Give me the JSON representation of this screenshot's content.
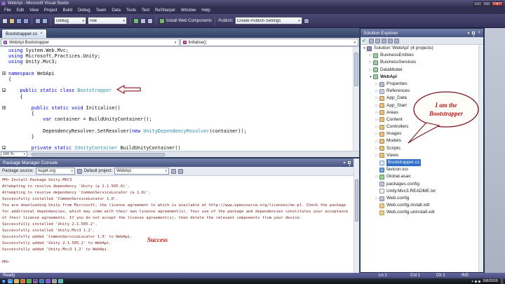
{
  "glyphs": {
    "chevron": "▾",
    "close": "×",
    "minimize": "–",
    "maximize": "□",
    "close_window": "✕",
    "expander_collapsed": "▷",
    "expander_expanded": "▾",
    "check": "✓",
    "tray_arrow": "▴",
    "vs_logo": "∞"
  },
  "colors": {
    "keyword": "#0000dd",
    "type": "#2b91af",
    "console_text": "#7b2323",
    "annotation_red": "#cc1111",
    "selection_blue": "#3170c8"
  },
  "titlebar": {
    "title": "WebApi - Microsoft Visual Studio"
  },
  "menubar": {
    "items": [
      "File",
      "Edit",
      "View",
      "Project",
      "Build",
      "Debug",
      "Team",
      "Data",
      "Tools",
      "Test",
      "ReSharper",
      "Window",
      "Help"
    ]
  },
  "toolbar": {
    "debug": "Debug",
    "role": "role",
    "install_web": "Install Web Components",
    "publish_label": "Publish:",
    "publish_value": "Create Publish Settings"
  },
  "editor": {
    "tab": "Bootstrapper.cs",
    "breadcrumb_type": "WebApi.Bootstrapper",
    "breadcrumb_member": "Initialise()",
    "zoom": "100 %",
    "outline_lines": [
      4,
      7,
      10,
      17
    ],
    "code": [
      [
        {
          "t": "using",
          "c": "k"
        },
        {
          "t": " System.Web.Mvc;",
          "c": "p"
        }
      ],
      [
        {
          "t": "using",
          "c": "k"
        },
        {
          "t": " Microsoft.Practices.Unity;",
          "c": "p"
        }
      ],
      [
        {
          "t": "using",
          "c": "k"
        },
        {
          "t": " Unity.Mvc3;",
          "c": "p"
        }
      ],
      [],
      [
        {
          "t": "namespace",
          "c": "k"
        },
        {
          "t": " WebApi",
          "c": "p"
        }
      ],
      [
        {
          "t": "{",
          "c": "p"
        }
      ],
      [],
      [
        {
          "t": "    ",
          "c": "p"
        },
        {
          "t": "public static class",
          "c": "k"
        },
        {
          "t": " ",
          "c": "p"
        },
        {
          "t": "Bootstrapper",
          "c": "t"
        }
      ],
      [
        {
          "t": "    {",
          "c": "p"
        }
      ],
      [],
      [
        {
          "t": "        ",
          "c": "p"
        },
        {
          "t": "public static void",
          "c": "k"
        },
        {
          "t": " Initialise()",
          "c": "p"
        }
      ],
      [
        {
          "t": "        {",
          "c": "p"
        }
      ],
      [
        {
          "t": "            ",
          "c": "p"
        },
        {
          "t": "var",
          "c": "k"
        },
        {
          "t": " container = BuildUnityContainer();",
          "c": "p"
        }
      ],
      [],
      [
        {
          "t": "            DependencyResolver.SetResolver(",
          "c": "p"
        },
        {
          "t": "new",
          "c": "k"
        },
        {
          "t": " ",
          "c": "p"
        },
        {
          "t": "UnityDependencyResolver",
          "c": "t"
        },
        {
          "t": "(container));",
          "c": "p"
        }
      ],
      [
        {
          "t": "        }",
          "c": "p"
        }
      ],
      [],
      [
        {
          "t": "        ",
          "c": "p"
        },
        {
          "t": "private static",
          "c": "k"
        },
        {
          "t": " ",
          "c": "p"
        },
        {
          "t": "IUnityContainer",
          "c": "t"
        },
        {
          "t": " BuildUnityContainer()",
          "c": "p"
        }
      ]
    ]
  },
  "console": {
    "title": "Package Manager Console",
    "package_source_label": "Package source:",
    "package_source": "nuget.org",
    "default_project_label": "Default project:",
    "default_project": "WebApi",
    "annotation": "Success",
    "lines": [
      "PM> Install-Package Unity.MVC3",
      "Attempting to resolve dependency 'Unity (≥ 2.1.505.0)'.",
      "Attempting to resolve dependency 'CommonServiceLocator (≥ 1.0)'.",
      "Successfully installed 'CommonServiceLocator 1.0'.",
      "You are downloading Unity from Microsoft, the license agreement to which is available at http://www.opensource.org/licenses/ms-pl. Check the package",
      "for additional dependencies, which may come with their own license agreement(s). Your use of the package and dependencies constitutes your acceptance",
      "of their license agreements. If you do not accept the license agreement(s), then delete the relevant components from your device.",
      "Successfully installed 'Unity 2.1.505.2'.",
      "Successfully installed 'Unity.Mvc3 1.2'.",
      "Successfully added 'CommonServiceLocator 1.0' to WebApi.",
      "Successfully added 'Unity 2.1.505.2' to WebApi.",
      "Successfully added 'Unity.Mvc3 1.2' to WebApi.",
      "",
      "PM>"
    ]
  },
  "solution_explorer": {
    "title": "Solution Explorer",
    "bubble_line1": "I am the",
    "bubble_line2": "Bootstrapper",
    "items": [
      {
        "label": "Solution 'WebApi' (4 projects)",
        "indent": 0,
        "expander": "expanded",
        "icon": "solution",
        "bold": false,
        "selected": false
      },
      {
        "label": "BusinessEntities",
        "indent": 1,
        "expander": "collapsed",
        "icon": "project",
        "bold": false,
        "selected": false
      },
      {
        "label": "BusinessServices",
        "indent": 1,
        "expander": "collapsed",
        "icon": "project",
        "bold": false,
        "selected": false
      },
      {
        "label": "DataModel",
        "indent": 1,
        "expander": "collapsed",
        "icon": "project",
        "bold": false,
        "selected": false
      },
      {
        "label": "WebApi",
        "indent": 1,
        "expander": "expanded",
        "icon": "project",
        "bold": true,
        "selected": false
      },
      {
        "label": "Properties",
        "indent": 2,
        "expander": "collapsed",
        "icon": "wrench",
        "bold": false,
        "selected": false
      },
      {
        "label": "References",
        "indent": 2,
        "expander": "collapsed",
        "icon": "refs",
        "bold": false,
        "selected": false
      },
      {
        "label": "App_Data",
        "indent": 2,
        "expander": "collapsed",
        "icon": "folder",
        "bold": false,
        "selected": false
      },
      {
        "label": "App_Start",
        "indent": 2,
        "expander": "collapsed",
        "icon": "folder",
        "bold": false,
        "selected": false
      },
      {
        "label": "Areas",
        "indent": 2,
        "expander": "collapsed",
        "icon": "folder",
        "bold": false,
        "selected": false
      },
      {
        "label": "Content",
        "indent": 2,
        "expander": "collapsed",
        "icon": "folder",
        "bold": false,
        "selected": false
      },
      {
        "label": "Controllers",
        "indent": 2,
        "expander": "collapsed",
        "icon": "folder",
        "bold": false,
        "selected": false
      },
      {
        "label": "Images",
        "indent": 2,
        "expander": "collapsed",
        "icon": "folder",
        "bold": false,
        "selected": false
      },
      {
        "label": "Models",
        "indent": 2,
        "expander": "collapsed",
        "icon": "folder",
        "bold": false,
        "selected": false
      },
      {
        "label": "Scripts",
        "indent": 2,
        "expander": "collapsed",
        "icon": "folder",
        "bold": false,
        "selected": false
      },
      {
        "label": "Views",
        "indent": 2,
        "expander": "collapsed",
        "icon": "folder",
        "bold": false,
        "selected": false
      },
      {
        "label": "Bootstrapper.cs",
        "indent": 2,
        "expander": "none",
        "icon": "cs",
        "bold": false,
        "selected": true
      },
      {
        "label": "favicon.ico",
        "indent": 2,
        "expander": "none",
        "icon": "ico",
        "bold": false,
        "selected": false
      },
      {
        "label": "Global.asax",
        "indent": 2,
        "expander": "collapsed",
        "icon": "asax",
        "bold": false,
        "selected": false
      },
      {
        "label": "packages.config",
        "indent": 2,
        "expander": "none",
        "icon": "config",
        "bold": false,
        "selected": false
      },
      {
        "label": "Unity.Mvc3.README.txt",
        "indent": 2,
        "expander": "none",
        "icon": "txt",
        "bold": false,
        "selected": false
      },
      {
        "label": "Web.config",
        "indent": 2,
        "expander": "collapsed",
        "icon": "config",
        "bold": false,
        "selected": false
      },
      {
        "label": "Web.config.install.xdt",
        "indent": 2,
        "expander": "none",
        "icon": "xml",
        "bold": false,
        "selected": false
      },
      {
        "label": "Web.config.uninstall.xdt",
        "indent": 2,
        "expander": "none",
        "icon": "xml",
        "bold": false,
        "selected": false
      }
    ]
  },
  "statusbar": {
    "ready": "Ready",
    "ln": "Ln 1",
    "col": "Col 1",
    "ch": "Ch 1",
    "ins": "INS"
  },
  "taskbar": {
    "date": "5/8/2015",
    "icons": [
      {
        "name": "internet-explorer-icon",
        "color": "#3f8fe0",
        "glyph": "e"
      },
      {
        "name": "file-explorer-icon",
        "color": "#d8b25a",
        "glyph": ""
      },
      {
        "name": "media-player-icon",
        "color": "#d06a2a",
        "glyph": ""
      },
      {
        "name": "browser-icon",
        "color": "#4aa84a",
        "glyph": ""
      },
      {
        "name": "visual-studio-icon",
        "color": "#6a3a8f",
        "glyph": "∞"
      },
      {
        "name": "office-app-icon",
        "color": "#2a7ab0",
        "glyph": ""
      },
      {
        "name": "app-icon",
        "color": "#7a4fd0",
        "glyph": ""
      },
      {
        "name": "app-icon",
        "color": "#999999",
        "glyph": ""
      },
      {
        "name": "app-icon",
        "color": "#50b8b0",
        "glyph": ""
      }
    ]
  }
}
